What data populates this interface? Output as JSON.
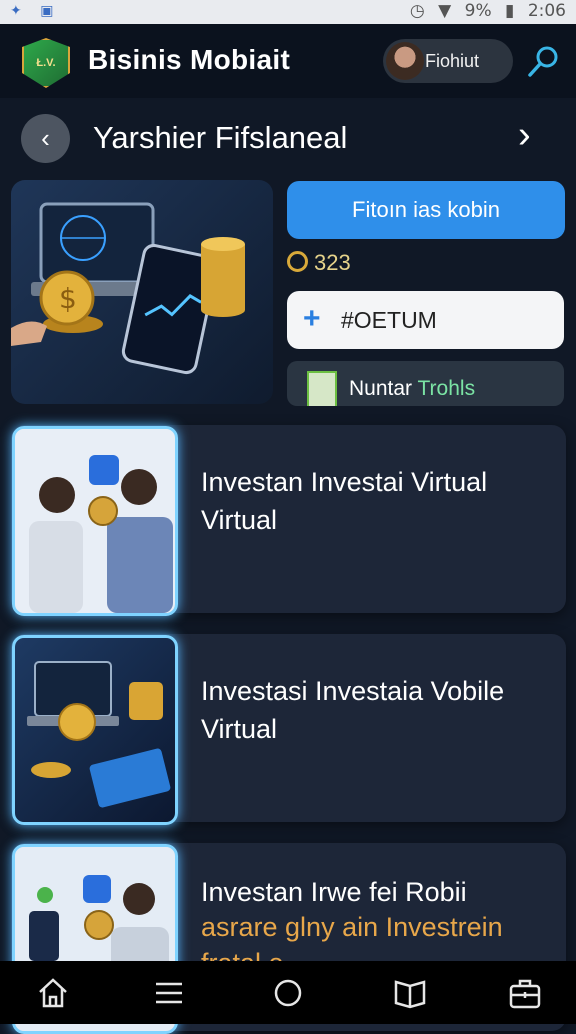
{
  "status_bar": {
    "battery": "9%",
    "time": "2:06"
  },
  "app_bar": {
    "logo_text": "Ł.V.",
    "title": "Bisinis Mobiait",
    "user_name": "Fiohiut",
    "search_icon": "search-icon"
  },
  "section": {
    "title": "Yarshier Fifslaneal"
  },
  "side_panel": {
    "cta_label": "Fitoın ias kobin",
    "coin_amount": "323",
    "code_value": "#OETUM",
    "team_prefix": "Nuntar",
    "team_suffix": "Trohls"
  },
  "cards": [
    {
      "title": "Investan Investai Virtual Virtual",
      "subtitle": ""
    },
    {
      "title": "Investasi Investaia Vobile Virtual",
      "subtitle": ""
    },
    {
      "title": "Investan Irwe fei Robii",
      "subtitle": "asrare glny ain Investrein fratal e"
    }
  ],
  "bottom_nav": {
    "items": [
      "home-icon",
      "menu-icon",
      "circle-icon",
      "book-icon",
      "briefcase-icon"
    ]
  },
  "colors": {
    "accent": "#2f8fea",
    "background": "#101826",
    "card": "#1d2638",
    "glow": "#7fd3ff"
  }
}
